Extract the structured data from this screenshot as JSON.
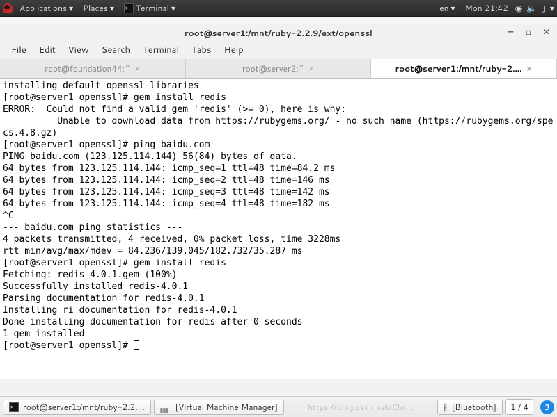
{
  "panel": {
    "applications": "Applications",
    "places": "Places",
    "launcher": "Terminal",
    "lang": "en",
    "clock": "Mon 21:42"
  },
  "window": {
    "title": "root@server1:/mnt/ruby-2.2.9/ext/openssl",
    "btn_min": "—",
    "btn_max": "▫",
    "btn_close": "✕"
  },
  "menu": {
    "file": "File",
    "edit": "Edit",
    "view": "View",
    "search": "Search",
    "terminal": "Terminal",
    "tabs": "Tabs",
    "help": "Help"
  },
  "tabs": [
    {
      "label": "root@foundation44:~",
      "active": false
    },
    {
      "label": "root@server2:~",
      "active": false
    },
    {
      "label": "root@server1:/mnt/ruby-2....",
      "active": true
    }
  ],
  "terminal_lines": [
    "installing default openssl libraries",
    "[root@server1 openssl]# gem install redis",
    "ERROR:  Could not find a valid gem 'redis' (>= 0), here is why:",
    "          Unable to download data from https://rubygems.org/ - no such name (https://rubygems.org/specs.4.8.gz)",
    "[root@server1 openssl]# ping baidu.com",
    "PING baidu.com (123.125.114.144) 56(84) bytes of data.",
    "64 bytes from 123.125.114.144: icmp_seq=1 ttl=48 time=84.2 ms",
    "64 bytes from 123.125.114.144: icmp_seq=2 ttl=48 time=146 ms",
    "64 bytes from 123.125.114.144: icmp_seq=3 ttl=48 time=142 ms",
    "64 bytes from 123.125.114.144: icmp_seq=4 ttl=48 time=182 ms",
    "^C",
    "--- baidu.com ping statistics ---",
    "4 packets transmitted, 4 received, 0% packet loss, time 3228ms",
    "rtt min/avg/max/mdev = 84.236/139.045/182.732/35.287 ms",
    "[root@server1 openssl]# gem install redis",
    "Fetching: redis-4.0.1.gem (100%)",
    "Successfully installed redis-4.0.1",
    "Parsing documentation for redis-4.0.1",
    "Installing ri documentation for redis-4.0.1",
    "Done installing documentation for redis after 0 seconds",
    "1 gem installed"
  ],
  "terminal_prompt": "[root@server1 openssl]# ",
  "taskbar": {
    "terminal": "root@server1:/mnt/ruby-2.2....",
    "vmm": "[Virtual Machine Manager]",
    "bluetooth": "[Bluetooth]",
    "watermark": "https://blog.csdn.net/Chr...",
    "workspace": "1 / 4",
    "badge": "3"
  }
}
